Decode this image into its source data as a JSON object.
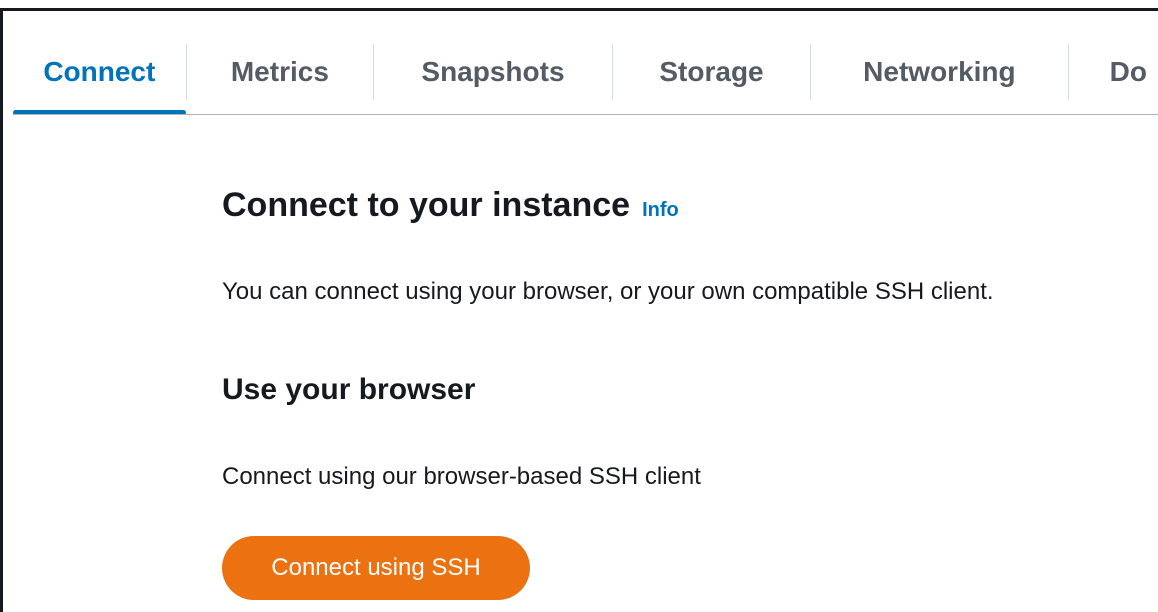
{
  "tabs": [
    {
      "label": "Connect",
      "active": true
    },
    {
      "label": "Metrics",
      "active": false
    },
    {
      "label": "Snapshots",
      "active": false
    },
    {
      "label": "Storage",
      "active": false
    },
    {
      "label": "Networking",
      "active": false
    },
    {
      "label": "Do",
      "active": false
    }
  ],
  "main": {
    "title": "Connect to your instance",
    "info_link": "Info",
    "description": "You can connect using your browser, or your own compatible SSH client.",
    "browser_section": {
      "title": "Use your browser",
      "description": "Connect using our browser-based SSH client",
      "button_label": "Connect using SSH"
    }
  },
  "colors": {
    "accent": "#0073bb",
    "primary_button": "#ec7211",
    "text": "#16191f",
    "tab_inactive": "#545b64"
  }
}
